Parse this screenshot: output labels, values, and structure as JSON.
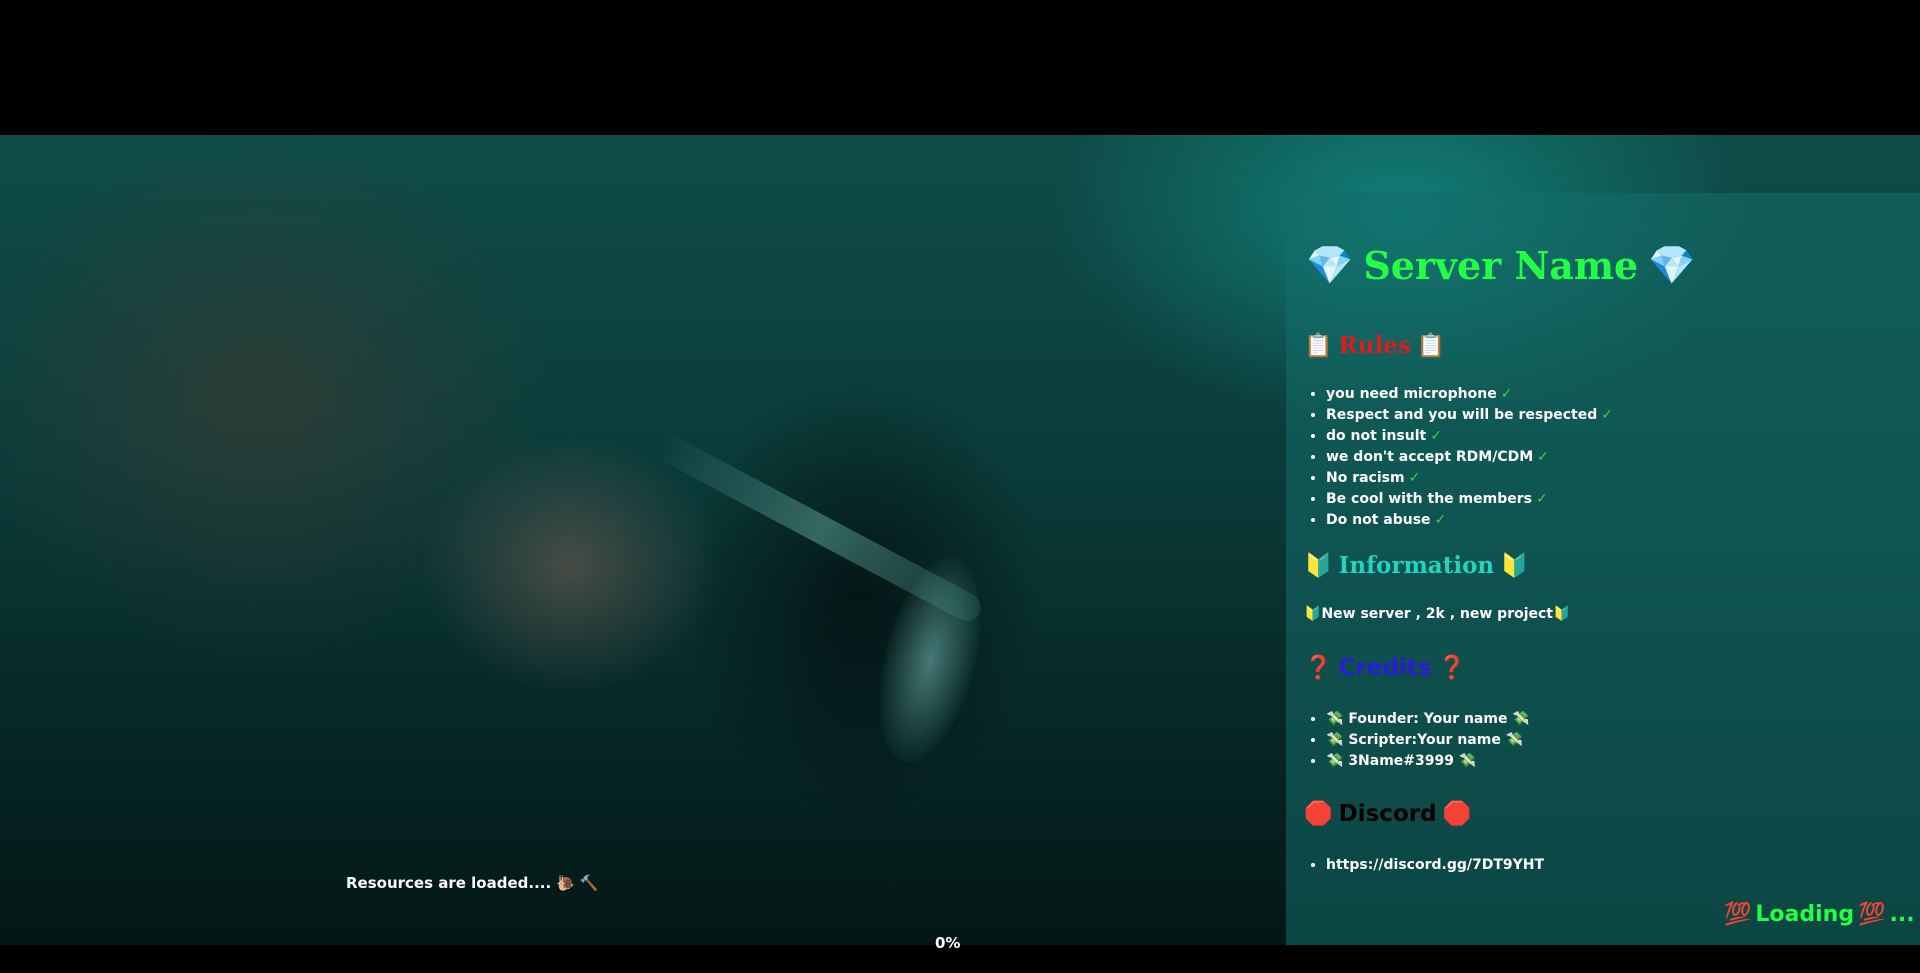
{
  "panel": {
    "title": "Server Name",
    "title_icon": "💎",
    "rules": {
      "title": "Rules",
      "icon": "📋",
      "items": [
        "you need microphone",
        "Respect and you will be respected",
        "do not insult",
        "we don't accept RDM/CDM",
        "No racism",
        "Be cool with the members",
        "Do not abuse"
      ],
      "check_icon": "✓"
    },
    "information": {
      "title": "Information",
      "icon": "🔰",
      "text": "New server , 2k , new project"
    },
    "credits": {
      "title": "Credits",
      "icon": "❓",
      "item_icon": "💸",
      "items": [
        "Founder: Your name",
        "Scripter:Your name",
        "3Name#3999"
      ]
    },
    "discord": {
      "title": "Discord",
      "icon": "🛑",
      "items": [
        "https://discord.gg/7DT9YHT"
      ]
    }
  },
  "resources_text": "Resources are loaded....",
  "resources_icons": "🐌 🔨",
  "progress_text": "0%",
  "loading": {
    "text": "Loading",
    "icon": "💯",
    "suffix": "..."
  },
  "colors": {
    "title_green": "#22ff44",
    "rules_red": "#e01b1b",
    "info_teal": "#22d4c0",
    "credits_blue": "#2a1cd6",
    "panel_bg": "rgba(20,110,105,0.55)"
  }
}
